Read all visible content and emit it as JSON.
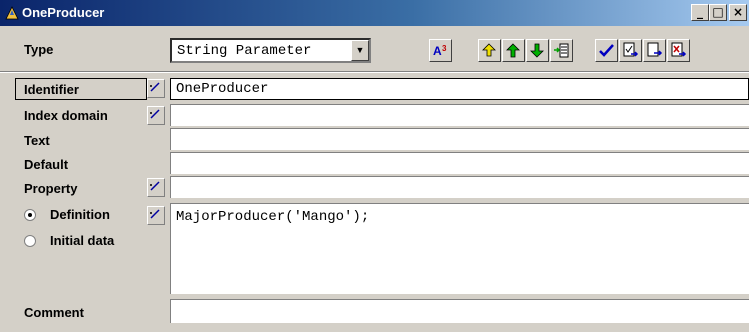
{
  "window": {
    "title": "OneProducer",
    "minimize": "_",
    "maximize": "□",
    "close": "×"
  },
  "toolbar": {
    "type_label": "Type",
    "type_value": "String Parameter",
    "buttons": [
      "A³",
      "back",
      "up",
      "down",
      "insert",
      "check",
      "apply",
      "export",
      "close"
    ]
  },
  "form": {
    "identifier": {
      "label": "Identifier",
      "value": "OneProducer"
    },
    "index_domain": {
      "label": "Index domain",
      "value": ""
    },
    "text": {
      "label": "Text",
      "value": ""
    },
    "default": {
      "label": "Default",
      "value": ""
    },
    "property": {
      "label": "Property",
      "value": ""
    },
    "definition": {
      "label": "Definition",
      "value": "MajorProducer('Mango');",
      "selected": true
    },
    "initial_data": {
      "label": "Initial data",
      "selected": false
    },
    "comment": {
      "label": "Comment",
      "value": ""
    }
  },
  "colors": {
    "title_start": "#0a246a",
    "title_end": "#a6caf0",
    "face": "#d4d0c8"
  }
}
